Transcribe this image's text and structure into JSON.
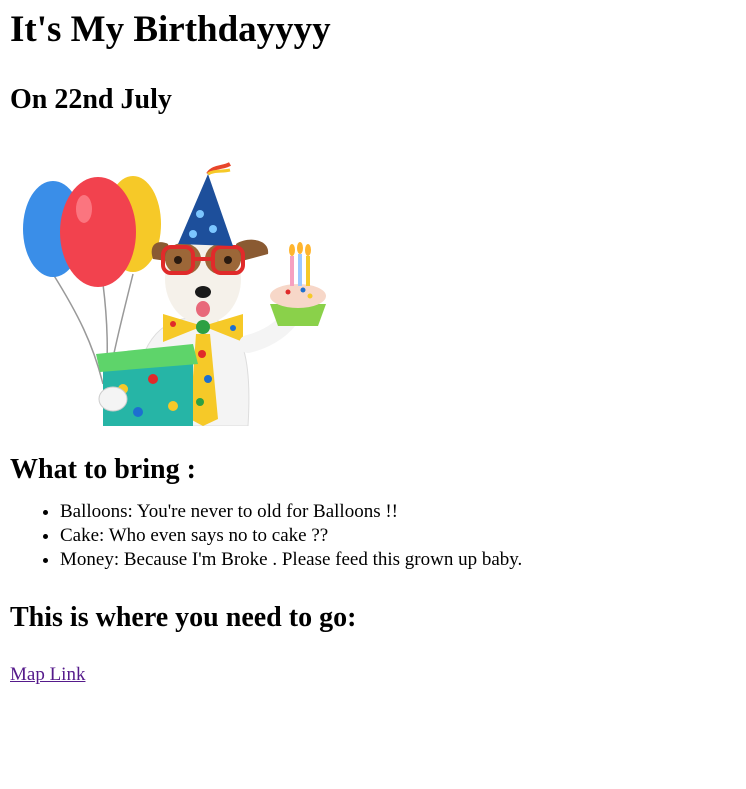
{
  "page": {
    "title": "It's My Birthdayyyy",
    "subtitle": "On 22nd July"
  },
  "image": {
    "icon": "birthday-dog-illustration",
    "colors": {
      "balloon_blue": "#3a8ee8",
      "balloon_red": "#f2424e",
      "balloon_yellow": "#f6c928",
      "hat_blue": "#1d4f9b",
      "gift_teal": "#26b5a6",
      "cupcake_green": "#8ad14a"
    }
  },
  "bring": {
    "heading": "What to bring :",
    "items": [
      "Balloons: You're never to old for Balloons !!",
      "Cake: Who even says no to cake ??",
      "Money: Because I'm Broke . Please feed this grown up baby."
    ]
  },
  "location": {
    "heading": "This is where you need to go:",
    "link_label": "Map Link",
    "link_color": "#551a8b"
  }
}
